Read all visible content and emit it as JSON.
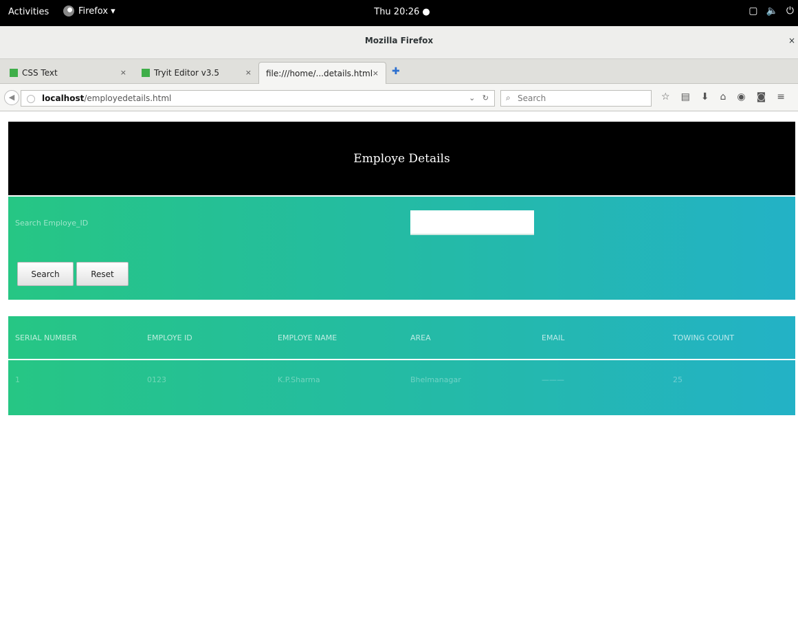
{
  "system_bar": {
    "activities": "Activities",
    "app_menu": "Firefox ▾",
    "clock": "Thu 20:26 ●",
    "tray_icons": [
      "window-icon",
      "volume-icon",
      "power-icon"
    ]
  },
  "window": {
    "title": "Mozilla Firefox",
    "close": "×"
  },
  "tabs": [
    {
      "label": "CSS Text",
      "close": "×"
    },
    {
      "label": "Tryit Editor v3.5",
      "close": "×"
    },
    {
      "label": "file:///home/...details.html",
      "close": "×"
    }
  ],
  "navbar": {
    "url_host": "localhost",
    "url_path": "/employedetails.html",
    "search_placeholder": "Search"
  },
  "page": {
    "header_title": "Employe Details",
    "search_label": "Search Employe_ID",
    "search_value": "",
    "search_button": "Search",
    "reset_button": "Reset",
    "table": {
      "columns": [
        "SERIAL NUMBER",
        "EMPLOYE ID",
        "EMPLOYE NAME",
        "AREA",
        "EMAIL",
        "TOWING COUNT"
      ],
      "rows": [
        [
          "1",
          "0123",
          "K.P.Sharma",
          "Bhelmanagar",
          "———",
          "25"
        ]
      ]
    }
  },
  "colors": {
    "panel_gradient_start": "#26c684",
    "panel_gradient_end": "#23b2c6",
    "header_bg": "#000000"
  }
}
